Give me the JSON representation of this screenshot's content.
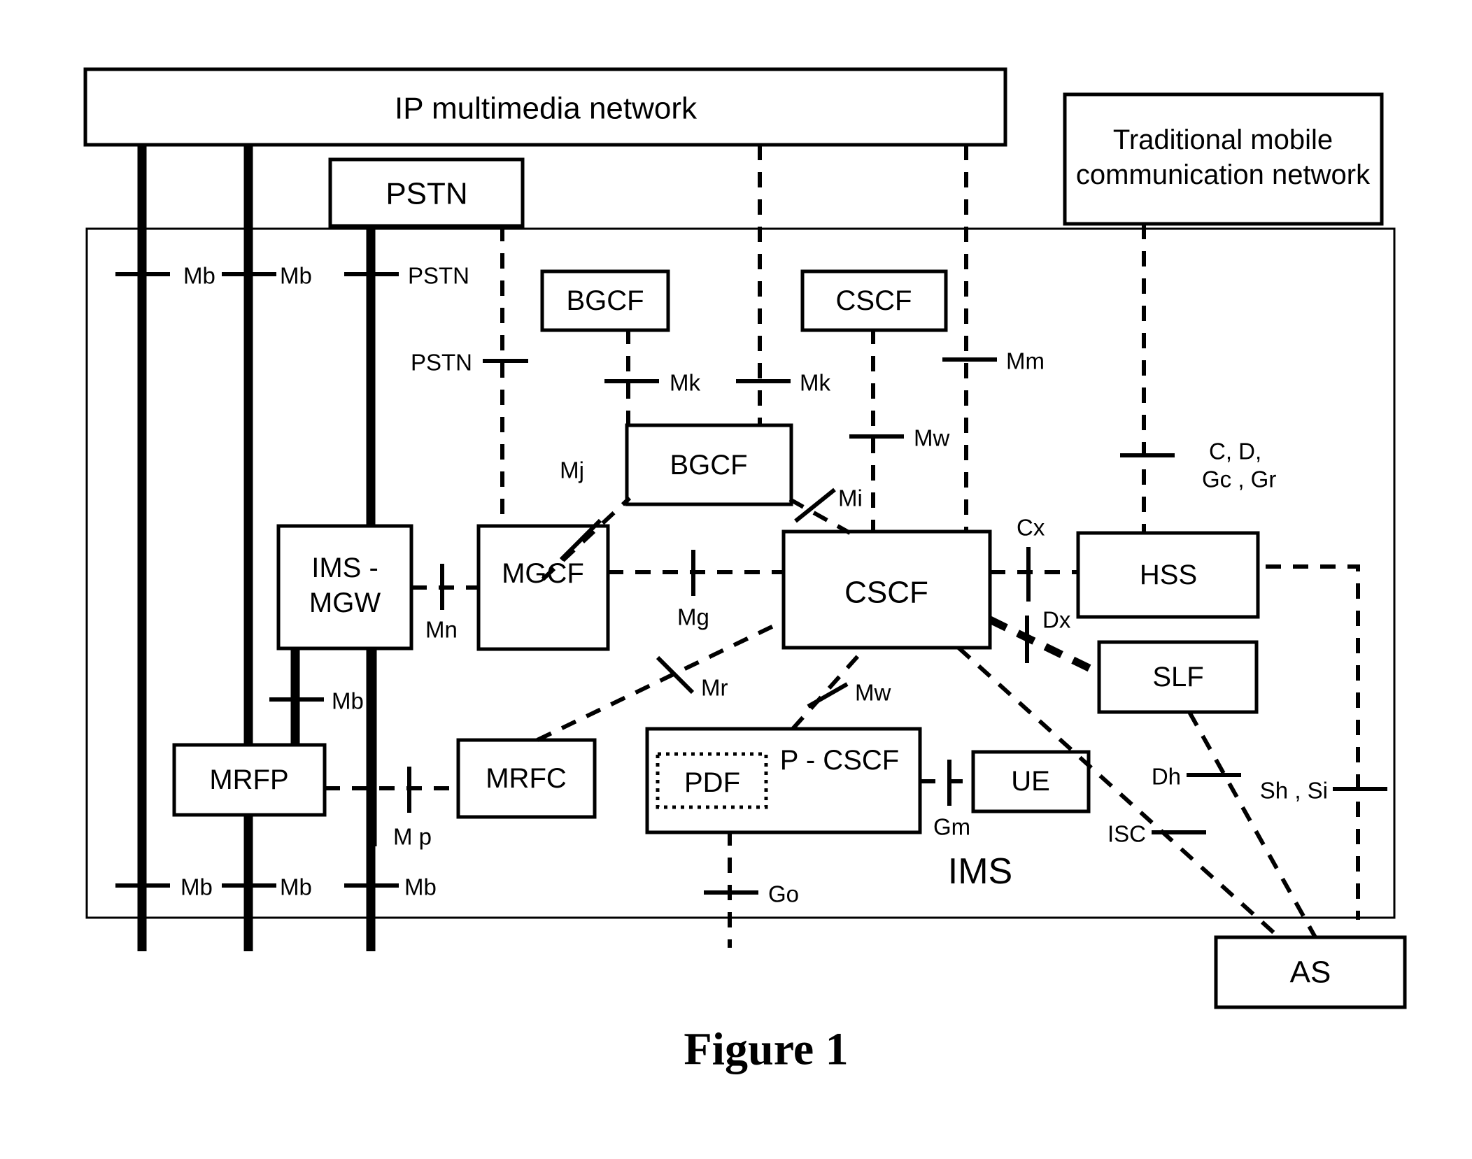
{
  "figure": {
    "caption": "Figure 1"
  },
  "external_networks": [
    {
      "id": "ip-multimedia-network",
      "label": "IP multimedia network"
    },
    {
      "id": "pstn",
      "label": "PSTN"
    },
    {
      "id": "traditional-mobile-network",
      "label_line1": "Traditional mobile",
      "label_line2": "communication network"
    }
  ],
  "ims": {
    "region_label": "IMS",
    "nodes": [
      {
        "id": "bgcf-upper",
        "label": "BGCF"
      },
      {
        "id": "cscf-upper",
        "label": "CSCF"
      },
      {
        "id": "bgcf-lower",
        "label": "BGCF"
      },
      {
        "id": "ims-mgw",
        "label_line1": "IMS -",
        "label_line2": "MGW"
      },
      {
        "id": "mgcf",
        "label": "MGCF"
      },
      {
        "id": "cscf-main",
        "label": "CSCF"
      },
      {
        "id": "hss",
        "label": "HSS"
      },
      {
        "id": "slf",
        "label": "SLF"
      },
      {
        "id": "mrfp",
        "label": "MRFP"
      },
      {
        "id": "mrfc",
        "label": "MRFC"
      },
      {
        "id": "p-cscf",
        "label": "P - CSCF"
      },
      {
        "id": "pdf",
        "label": "PDF"
      },
      {
        "id": "ue",
        "label": "UE"
      },
      {
        "id": "as",
        "label": "AS"
      }
    ]
  },
  "interfaces": [
    {
      "id": "if-mb-top-1",
      "label": "Mb"
    },
    {
      "id": "if-mb-top-2",
      "label": "Mb"
    },
    {
      "id": "if-pstn-top",
      "label": "PSTN"
    },
    {
      "id": "if-pstn-mgcf",
      "label": "PSTN"
    },
    {
      "id": "if-mk-bgcf",
      "label": "Mk"
    },
    {
      "id": "if-mk-ipnet",
      "label": "Mk"
    },
    {
      "id": "if-mm",
      "label": "Mm"
    },
    {
      "id": "if-mw-upper",
      "label": "Mw"
    },
    {
      "id": "if-c-d-gc-gr",
      "label_line1": "C, D,",
      "label_line2": "Gc , Gr"
    },
    {
      "id": "if-mj",
      "label": "Mj"
    },
    {
      "id": "if-mi",
      "label": "Mi"
    },
    {
      "id": "if-cx",
      "label": "Cx"
    },
    {
      "id": "if-mn",
      "label": "Mn"
    },
    {
      "id": "if-mg",
      "label": "Mg"
    },
    {
      "id": "if-dx",
      "label": "Dx"
    },
    {
      "id": "if-mb-mgw",
      "label": "Mb"
    },
    {
      "id": "if-mr",
      "label": "Mr"
    },
    {
      "id": "if-mw-lower",
      "label": "Mw"
    },
    {
      "id": "if-mp",
      "label": "M p"
    },
    {
      "id": "if-gm",
      "label": "Gm"
    },
    {
      "id": "if-dh",
      "label": "Dh"
    },
    {
      "id": "if-sh-si",
      "label": "Sh , Si"
    },
    {
      "id": "if-isc",
      "label": "ISC"
    },
    {
      "id": "if-mb-bot-1",
      "label": "Mb"
    },
    {
      "id": "if-mb-bot-2",
      "label": "Mb"
    },
    {
      "id": "if-mb-bot-3",
      "label": "Mb"
    },
    {
      "id": "if-go",
      "label": "Go"
    }
  ],
  "colors": {
    "stroke": "#000000",
    "background": "#ffffff"
  }
}
